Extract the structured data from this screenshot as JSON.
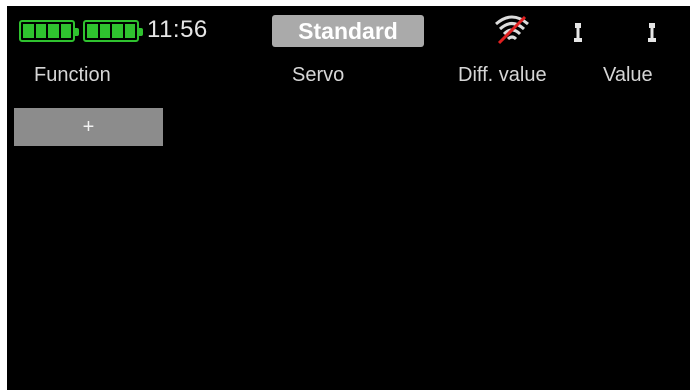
{
  "status_bar": {
    "time": "11:56",
    "mode_label": "Standard",
    "battery_color": "#2fc22f",
    "icons": [
      "battery-icon",
      "battery-icon",
      "wifi-off-icon",
      "trim-icon",
      "trim-icon"
    ]
  },
  "table": {
    "columns": [
      "Function",
      "Servo",
      "Diff. value",
      "Value"
    ]
  },
  "add_button": {
    "label": "+"
  }
}
